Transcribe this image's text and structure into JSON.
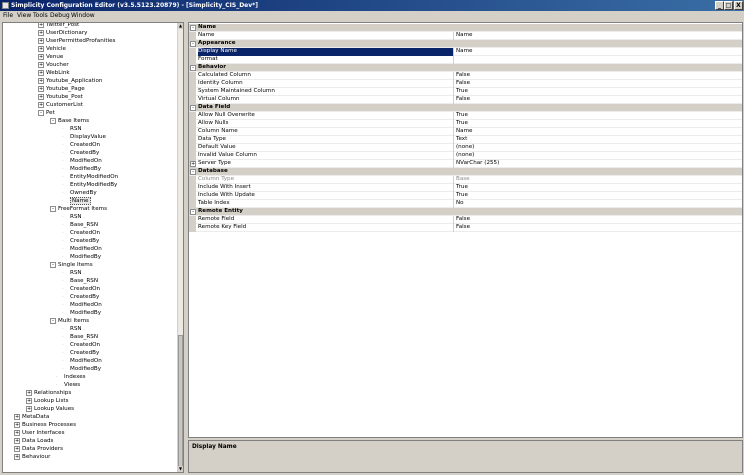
{
  "window": {
    "title": "Simplicity Configuration Editor (v3.5.5123.20879) - [Simplicity_CIS_Dev*]",
    "buttons": [
      "_",
      "□",
      "X"
    ]
  },
  "menu": [
    "File",
    "View",
    "Tools",
    "Debug",
    "Window"
  ],
  "tree": [
    {
      "label": "Twitter_Post",
      "exp": "+"
    },
    {
      "label": "UserDictionary",
      "exp": "+"
    },
    {
      "label": "UserPermittedProfanities",
      "exp": "+"
    },
    {
      "label": "Vehicle",
      "exp": "+"
    },
    {
      "label": "Venue",
      "exp": "+"
    },
    {
      "label": "Voucher",
      "exp": "+"
    },
    {
      "label": "WebLink",
      "exp": "+"
    },
    {
      "label": "Youtube_Application",
      "exp": "+"
    },
    {
      "label": "Youtube_Page",
      "exp": "+"
    },
    {
      "label": "Youtube_Post",
      "exp": "+"
    },
    {
      "label": "CustomerList",
      "exp": "+"
    },
    {
      "label": "Pet",
      "exp": "-"
    },
    {
      "label": "Base Items",
      "exp": "-"
    },
    {
      "label": "RSN",
      "exp": ""
    },
    {
      "label": "DisplayValue",
      "exp": ""
    },
    {
      "label": "CreatedOn",
      "exp": ""
    },
    {
      "label": "CreatedBy",
      "exp": ""
    },
    {
      "label": "ModifiedOn",
      "exp": ""
    },
    {
      "label": "ModifiedBy",
      "exp": ""
    },
    {
      "label": "EntityModifiedOn",
      "exp": ""
    },
    {
      "label": "EntityModifiedBy",
      "exp": ""
    },
    {
      "label": "OwnedBy",
      "exp": ""
    },
    {
      "label": "Name",
      "exp": "",
      "selected": true
    },
    {
      "label": "FreeFormat Items",
      "exp": "-"
    },
    {
      "label": "RSN",
      "exp": ""
    },
    {
      "label": "Base_RSN",
      "exp": ""
    },
    {
      "label": "CreatedOn",
      "exp": ""
    },
    {
      "label": "CreatedBy",
      "exp": ""
    },
    {
      "label": "ModifiedOn",
      "exp": ""
    },
    {
      "label": "ModifiedBy",
      "exp": ""
    },
    {
      "label": "Single Items",
      "exp": "-"
    },
    {
      "label": "RSN",
      "exp": ""
    },
    {
      "label": "Base_RSN",
      "exp": ""
    },
    {
      "label": "CreatedOn",
      "exp": ""
    },
    {
      "label": "CreatedBy",
      "exp": ""
    },
    {
      "label": "ModifiedOn",
      "exp": ""
    },
    {
      "label": "ModifiedBy",
      "exp": ""
    },
    {
      "label": "Multi Items",
      "exp": "-"
    },
    {
      "label": "RSN",
      "exp": ""
    },
    {
      "label": "Base_RSN",
      "exp": ""
    },
    {
      "label": "CreatedOn",
      "exp": ""
    },
    {
      "label": "CreatedBy",
      "exp": ""
    },
    {
      "label": "ModifiedOn",
      "exp": ""
    },
    {
      "label": "ModifiedBy",
      "exp": ""
    },
    {
      "label": "Indexes",
      "exp": ""
    },
    {
      "label": "Views",
      "exp": ""
    },
    {
      "label": "Relationships",
      "exp": "+"
    },
    {
      "label": "Lookup Lists",
      "exp": "+"
    },
    {
      "label": "Lookup Values",
      "exp": "+"
    },
    {
      "label": "MetaData",
      "exp": "+"
    },
    {
      "label": "Business Processes",
      "exp": "+"
    },
    {
      "label": "User Interfaces",
      "exp": "+"
    },
    {
      "label": "Data Loads",
      "exp": "+"
    },
    {
      "label": "Data Providers",
      "exp": "+"
    },
    {
      "label": "Behaviour",
      "exp": "+"
    }
  ],
  "properties": [
    {
      "kind": "category",
      "name": "Name"
    },
    {
      "kind": "prop",
      "name": "Name",
      "value": "Name"
    },
    {
      "kind": "category",
      "name": "Appearance"
    },
    {
      "kind": "prop",
      "name": "Display Name",
      "value": "Name",
      "selected": true
    },
    {
      "kind": "prop",
      "name": "Format",
      "value": ""
    },
    {
      "kind": "category",
      "name": "Behavior"
    },
    {
      "kind": "prop",
      "name": "Calculated Column",
      "value": "False"
    },
    {
      "kind": "prop",
      "name": "Identity Column",
      "value": "False"
    },
    {
      "kind": "prop",
      "name": "System Maintained Column",
      "value": "True"
    },
    {
      "kind": "prop",
      "name": "Virtual Column",
      "value": "False"
    },
    {
      "kind": "category",
      "name": "Data Field"
    },
    {
      "kind": "prop",
      "name": "Allow Null Overwrite",
      "value": "True"
    },
    {
      "kind": "prop",
      "name": "Allow Nulls",
      "value": "True"
    },
    {
      "kind": "prop",
      "name": "Column Name",
      "value": "Name"
    },
    {
      "kind": "prop",
      "name": "Data Type",
      "value": "Text"
    },
    {
      "kind": "prop",
      "name": "Default Value",
      "value": "(none)"
    },
    {
      "kind": "prop",
      "name": "Invalid Value Column",
      "value": "(none)"
    },
    {
      "kind": "prop",
      "name": "Server Type",
      "value": "NVarChar (255)",
      "exp": "+"
    },
    {
      "kind": "category",
      "name": "Database"
    },
    {
      "kind": "prop",
      "name": "Column Type",
      "value": "Base",
      "readonly": true
    },
    {
      "kind": "prop",
      "name": "Include With Insert",
      "value": "True"
    },
    {
      "kind": "prop",
      "name": "Include With Update",
      "value": "True"
    },
    {
      "kind": "prop",
      "name": "Table Index",
      "value": "No"
    },
    {
      "kind": "category",
      "name": "Remote Entity"
    },
    {
      "kind": "prop",
      "name": "Remote Field",
      "value": "False"
    },
    {
      "kind": "prop",
      "name": "Remote Key Field",
      "value": "False"
    }
  ],
  "description": {
    "title": "Display Name"
  }
}
